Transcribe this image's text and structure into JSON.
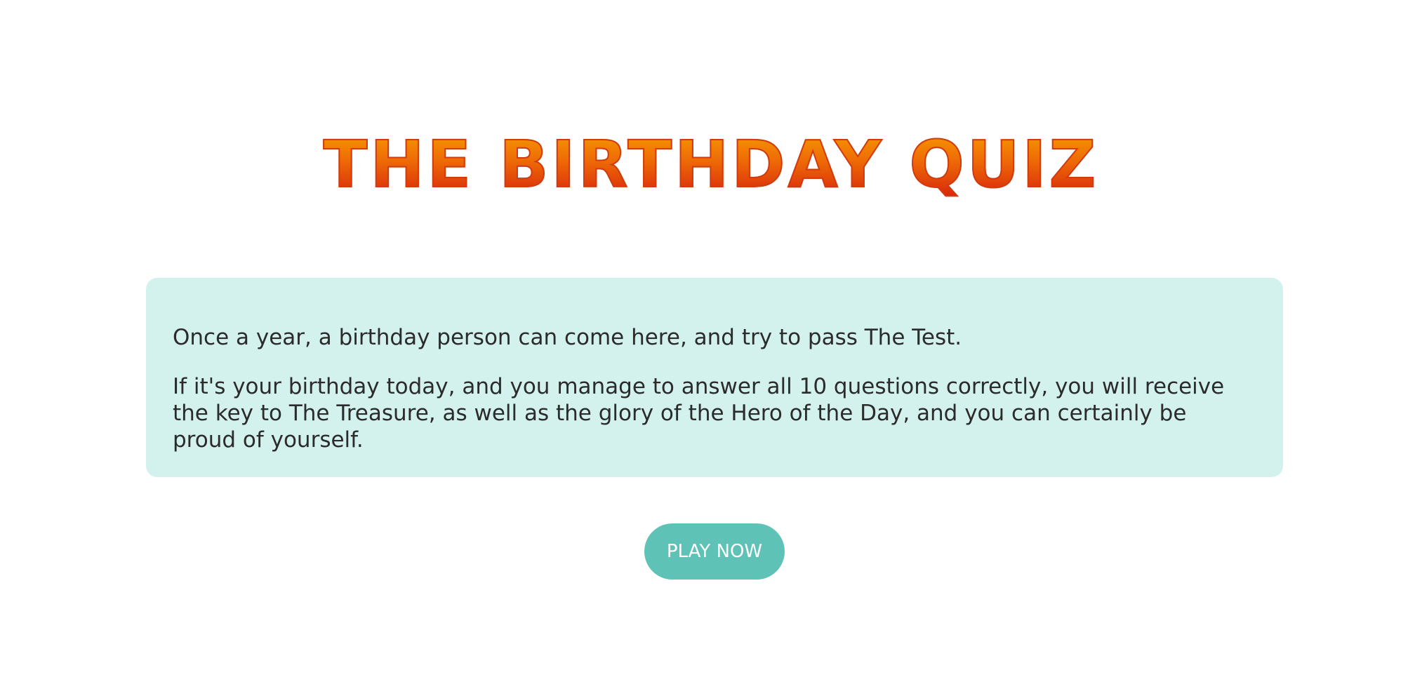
{
  "header": {
    "title": "THE BIRTHDAY QUIZ"
  },
  "intro": {
    "paragraph_1": "Once a year, a birthday person can come here, and try to pass The Test.",
    "paragraph_2": "If it's your birthday today, and you manage to answer all 10 questions correctly, you will receive the key to The Treasure, as well as the glory of the Hero of the Day, and you can certainly be proud of yourself."
  },
  "actions": {
    "play_label": "PLAY NOW"
  },
  "colors": {
    "title_gradient_top": "#f7a100",
    "title_gradient_bottom": "#d41a0c",
    "card_background": "#d3f2ee",
    "button_background": "#5fc2b6",
    "button_text": "#ffffff",
    "body_text": "#2b2b2b"
  }
}
